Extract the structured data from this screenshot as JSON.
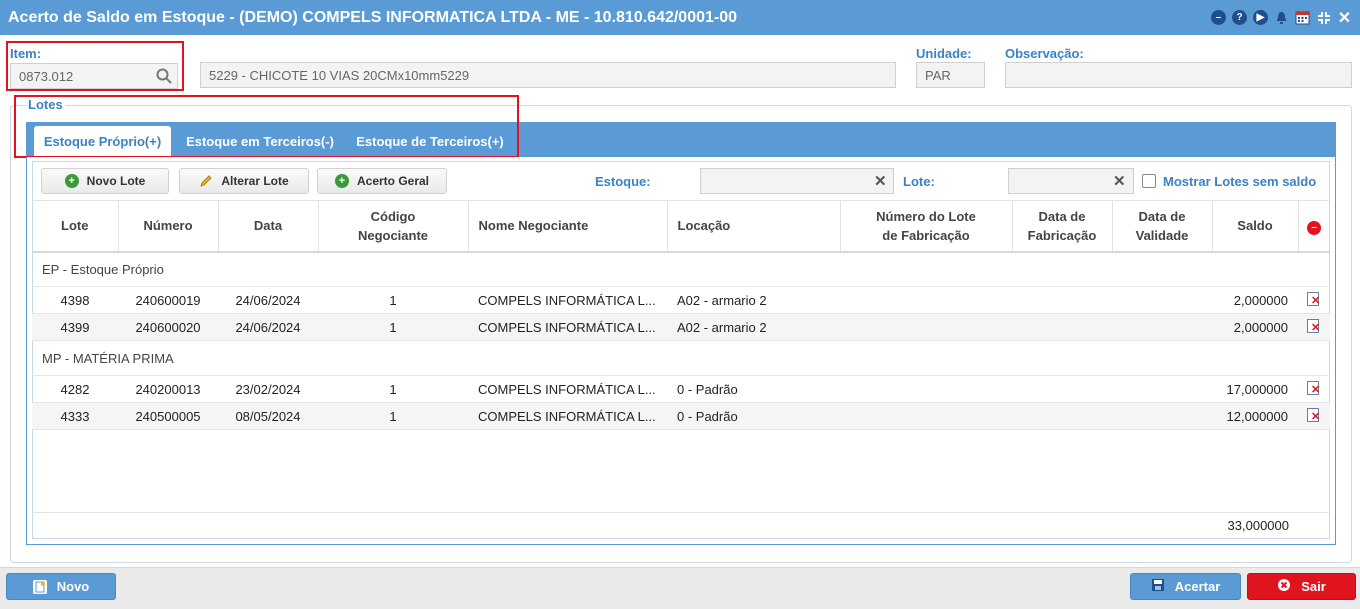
{
  "window": {
    "title": "Acerto de Saldo em Estoque - (DEMO) COMPELS INFORMATICA LTDA - ME - 10.810.642/0001-00"
  },
  "header": {
    "item_label": "Item:",
    "item_value": "0873.012",
    "item_description": "5229 - CHICOTE 10 VIAS 20CMx10mm5229",
    "unidade_label": "Unidade:",
    "unidade_value": "PAR",
    "observacao_label": "Observação:",
    "observacao_value": ""
  },
  "lotes": {
    "legend": "Lotes",
    "tabs": [
      {
        "label": "Estoque Próprio(+)"
      },
      {
        "label": "Estoque em Terceiros(-)"
      },
      {
        "label": "Estoque de Terceiros(+)"
      }
    ],
    "toolbar": {
      "novo_lote": "Novo Lote",
      "alterar_lote": "Alterar Lote",
      "acerto_geral": "Acerto Geral",
      "estoque_label": "Estoque:",
      "lote_label": "Lote:",
      "mostrar_label": "Mostrar Lotes sem saldo"
    },
    "columns": {
      "lote": "Lote",
      "numero": "Número",
      "data": "Data",
      "codigo_l1": "Código",
      "codigo_l2": "Negociante",
      "nome": "Nome Negociante",
      "locacao": "Locação",
      "numfab_l1": "Número do Lote",
      "numfab_l2": "de Fabricação",
      "datafab_l1": "Data de",
      "datafab_l2": "Fabricação",
      "dataval_l1": "Data de",
      "dataval_l2": "Validade",
      "saldo": "Saldo"
    },
    "groups": [
      {
        "name": "EP - Estoque Próprio",
        "rows": [
          {
            "lote": "4398",
            "numero": "240600019",
            "data": "24/06/2024",
            "codigo": "1",
            "nome": "COMPELS INFORMÁTICA L...",
            "locacao": "A02 - armario 2",
            "saldo": "2,000000"
          },
          {
            "lote": "4399",
            "numero": "240600020",
            "data": "24/06/2024",
            "codigo": "1",
            "nome": "COMPELS INFORMÁTICA L...",
            "locacao": "A02 - armario 2",
            "saldo": "2,000000"
          }
        ]
      },
      {
        "name": "MP - MATÉRIA PRIMA",
        "rows": [
          {
            "lote": "4282",
            "numero": "240200013",
            "data": "23/02/2024",
            "codigo": "1",
            "nome": "COMPELS INFORMÁTICA L...",
            "locacao": "0 - Padrão",
            "saldo": "17,000000"
          },
          {
            "lote": "4333",
            "numero": "240500005",
            "data": "08/05/2024",
            "codigo": "1",
            "nome": "COMPELS INFORMÁTICA L...",
            "locacao": "0 - Padrão",
            "saldo": "12,000000"
          }
        ]
      }
    ],
    "total": "33,000000"
  },
  "footer": {
    "novo": "Novo",
    "acertar": "Acertar",
    "sair": "Sair"
  },
  "colors": {
    "accent": "#5b9bd5",
    "label_blue": "#3b82c4",
    "highlight_red": "#e0141e"
  }
}
